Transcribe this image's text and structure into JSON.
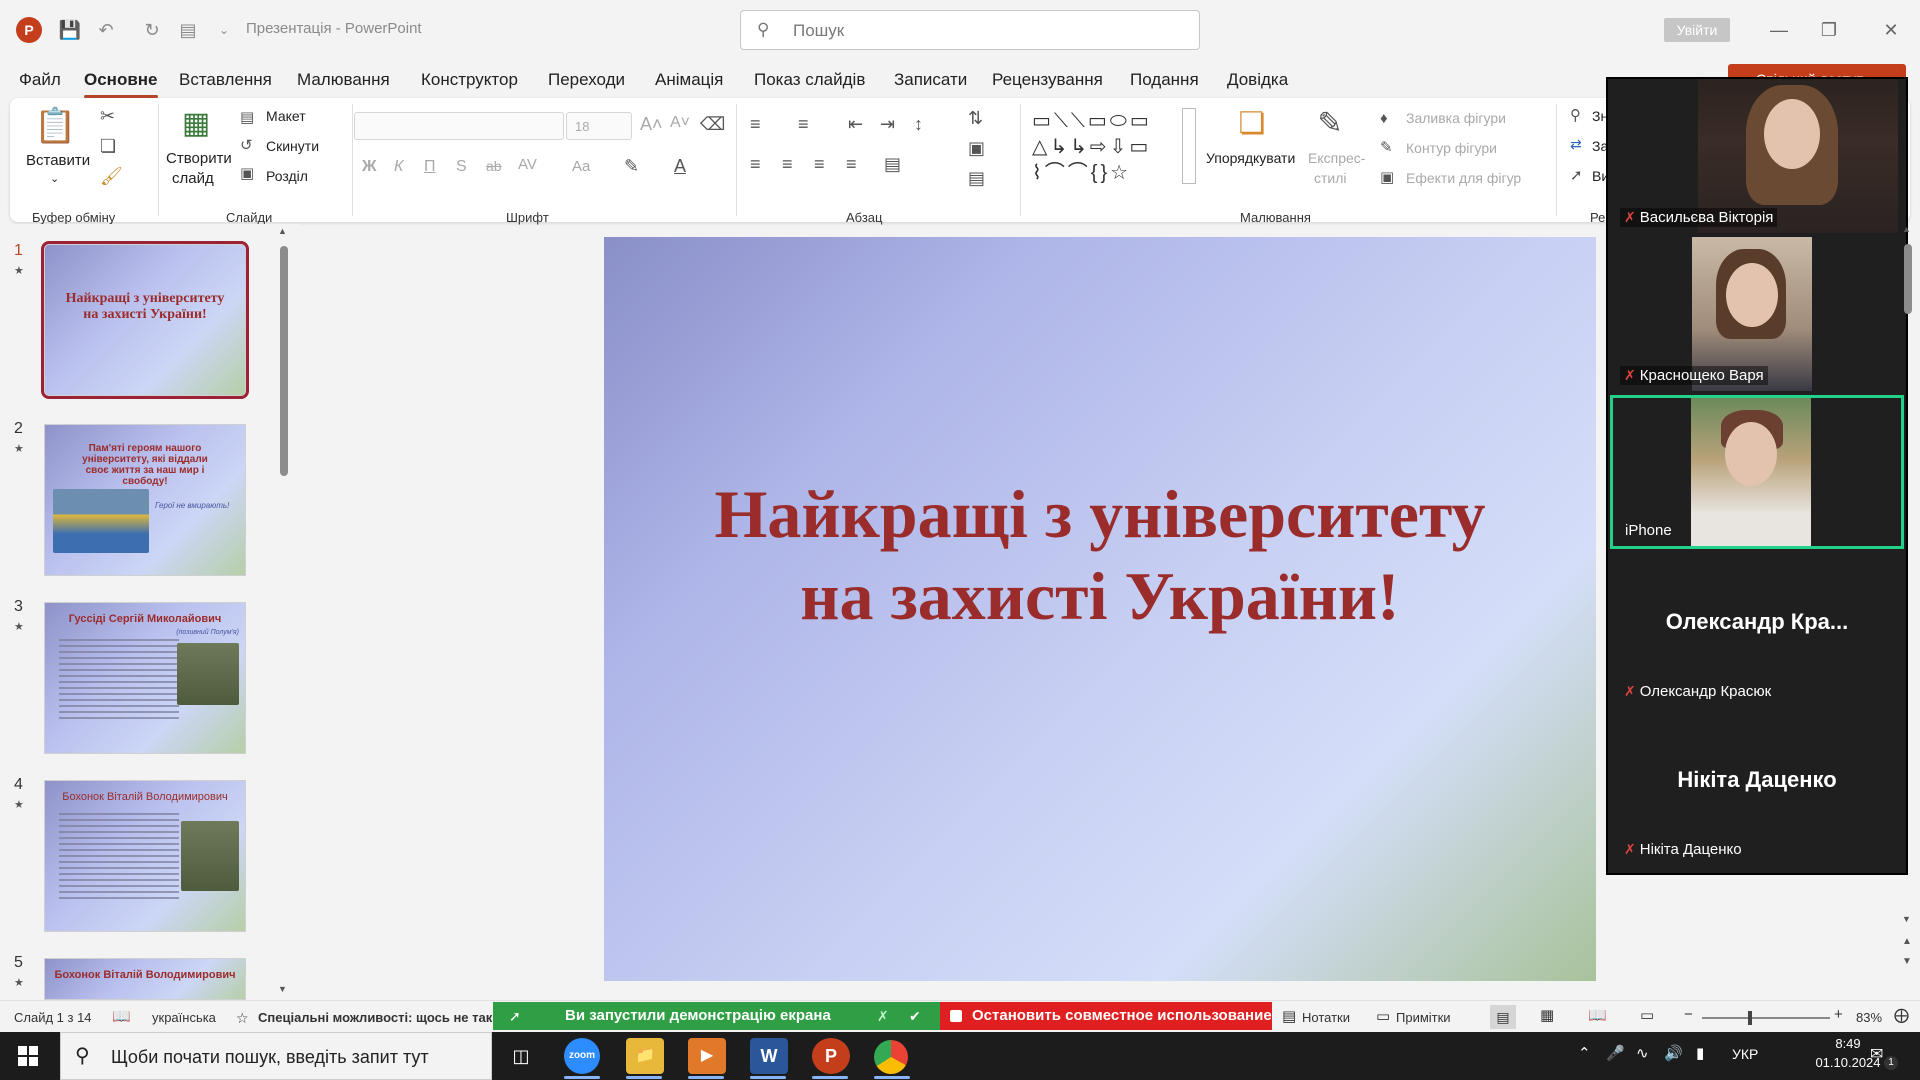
{
  "app": {
    "title": "Презентація  -  PowerPoint",
    "search_placeholder": "Пошук",
    "signin": "Увійти",
    "share": "Спільний доступ"
  },
  "menu": [
    "Файл",
    "Основне",
    "Вставлення",
    "Малювання",
    "Конструктор",
    "Переходи",
    "Анімація",
    "Показ слайдів",
    "Записати",
    "Рецензування",
    "Подання",
    "Довідка"
  ],
  "menu_active": "Основне",
  "ribbon": {
    "clipboard": {
      "paste": "Вставити",
      "group": "Буфер обміну"
    },
    "slides": {
      "new_slide_1": "Створити",
      "new_slide_2": "слайд",
      "layout": "Макет",
      "reset": "Скинути",
      "section": "Розділ",
      "group": "Слайди"
    },
    "font": {
      "size": "18",
      "group": "Шрифт",
      "bold": "Ж",
      "italic": "К",
      "underline": "П",
      "shadow": "S",
      "strike": "ab",
      "spacing": "AV",
      "case": "Aa",
      "grow": "A˄",
      "shrink": "A˅"
    },
    "paragraph": {
      "group": "Абзац"
    },
    "drawing": {
      "arrange": "Упорядкувати",
      "quick_styles_1": "Експрес-",
      "quick_styles_2": "стилі",
      "fill": "Заливка фігури",
      "outline": "Контур фігури",
      "effects": "Ефекти для фігур",
      "group": "Малювання"
    },
    "editing": {
      "find": "Зн",
      "replace": "За",
      "select": "Ви",
      "group": "Ре"
    }
  },
  "thumbnails": [
    {
      "num": "1",
      "title": "Найкращі з університету на захисті України!"
    },
    {
      "num": "2",
      "title": "Пам'яті героям нашого університету, які віддали своє життя за наш мир і свободу!",
      "caption": "Герої не вмирають!"
    },
    {
      "num": "3",
      "title": "Гуссіді Сергій Миколайович",
      "subtitle": "(позивний Полум'я)"
    },
    {
      "num": "4",
      "title": "Бохонок Віталій Володимирович"
    },
    {
      "num": "5",
      "title": "Бохонок Віталій Володимирович"
    }
  ],
  "slide": {
    "title_line1": "Найкращі з університету",
    "title_line2": "на захисті України!"
  },
  "zoom": {
    "participants": [
      {
        "name": "Васильєва Вікторія",
        "muted": true
      },
      {
        "name": "Краснощеко Варя",
        "muted": true
      },
      {
        "name": "iPhone",
        "muted": false
      },
      {
        "name": "Олександр Красюк",
        "display": "Олександр  Кра...",
        "muted": true
      },
      {
        "name": "Нікіта Даценко",
        "display": "Нікіта Даценко",
        "muted": true
      }
    ]
  },
  "status": {
    "slide_info": "Слайд 1 з 14",
    "language": "українська",
    "accessibility": "Спеціальні можливості: щось не так",
    "share_banner": "Ви запустили демонстрацію екрана",
    "stop_share": "Остановить совместное использование",
    "notes": "Нотатки",
    "comments": "Примітки",
    "zoom": "83%"
  },
  "taskbar": {
    "search_placeholder": "Щоби почати пошук, введіть запит тут",
    "apps": [
      "zoom",
      "Провідник",
      "Медіа",
      "Word",
      "PowerPoint",
      "Chrome"
    ],
    "lang": "УКР",
    "time": "8:49",
    "date": "01.10.2024",
    "notif": "1"
  },
  "colors": {
    "accent": "#b7472a",
    "title_red": "#9b2c2c",
    "zoom_green": "#23d18b",
    "stop_red": "#e02020",
    "share_green": "#2f9e44"
  }
}
